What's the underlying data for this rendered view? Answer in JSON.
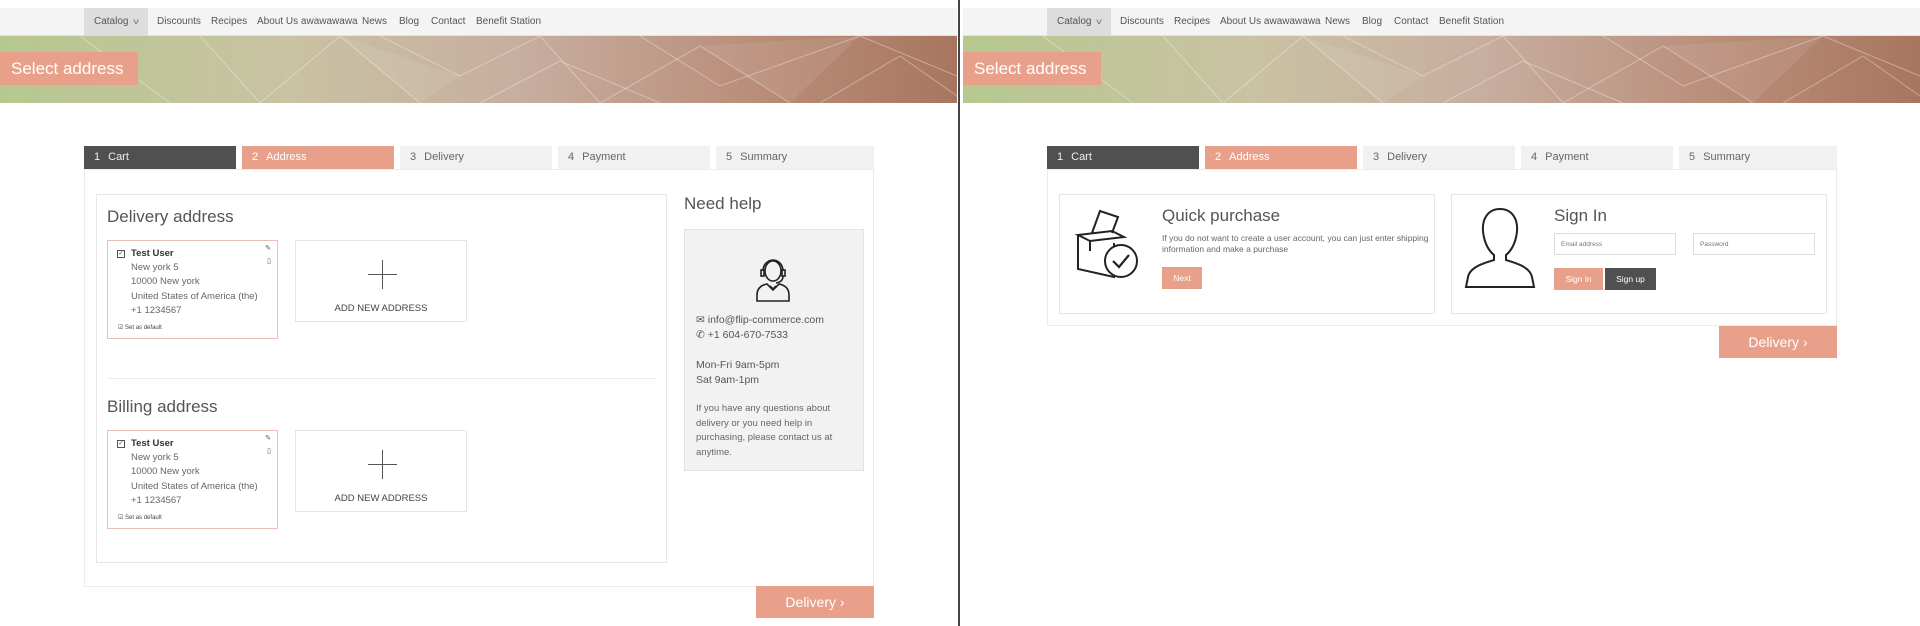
{
  "nav": {
    "items": [
      "Catalog",
      "Discounts",
      "Recipes",
      "About Us awawawawa",
      "News",
      "Blog",
      "Contact",
      "Benefit Station"
    ]
  },
  "banner": {
    "title": "Select address"
  },
  "steps": [
    {
      "num": "1",
      "label": "Cart"
    },
    {
      "num": "2",
      "label": "Address"
    },
    {
      "num": "3",
      "label": "Delivery"
    },
    {
      "num": "4",
      "label": "Payment"
    },
    {
      "num": "5",
      "label": "Summary"
    }
  ],
  "left": {
    "delivery_title": "Delivery address",
    "billing_title": "Billing address",
    "address": {
      "name": "Test User",
      "street": "New york 5",
      "city": "10000 New york",
      "country": "United States of America (the)",
      "phone": "+1  1234567",
      "default_label": "Set as default"
    },
    "add_new_label": "ADD NEW ADDRESS",
    "help": {
      "title": "Need help",
      "email": "info@flip-commerce.com",
      "phone": "+1 604-670-7533",
      "hours_weekday": "Mon-Fri 9am-5pm",
      "hours_saturday": "Sat 9am-1pm",
      "text": "If you have any questions about delivery or you need help in purchasing, please contact us at anytime."
    },
    "delivery_button": "Delivery"
  },
  "right": {
    "quick": {
      "title": "Quick purchase",
      "text": "If you do not want to create a user account, you can just enter shipping information and make a purchase",
      "next_button": "Next"
    },
    "signin": {
      "title": "Sign In",
      "email_placeholder": "Email address",
      "password_placeholder": "Password",
      "signin_button": "Sign in",
      "signup_button": "Sign up"
    },
    "delivery_button": "Delivery"
  },
  "colors": {
    "accent": "#e9a08a",
    "dark": "#505050",
    "step_inactive": "#f1f1f1"
  }
}
